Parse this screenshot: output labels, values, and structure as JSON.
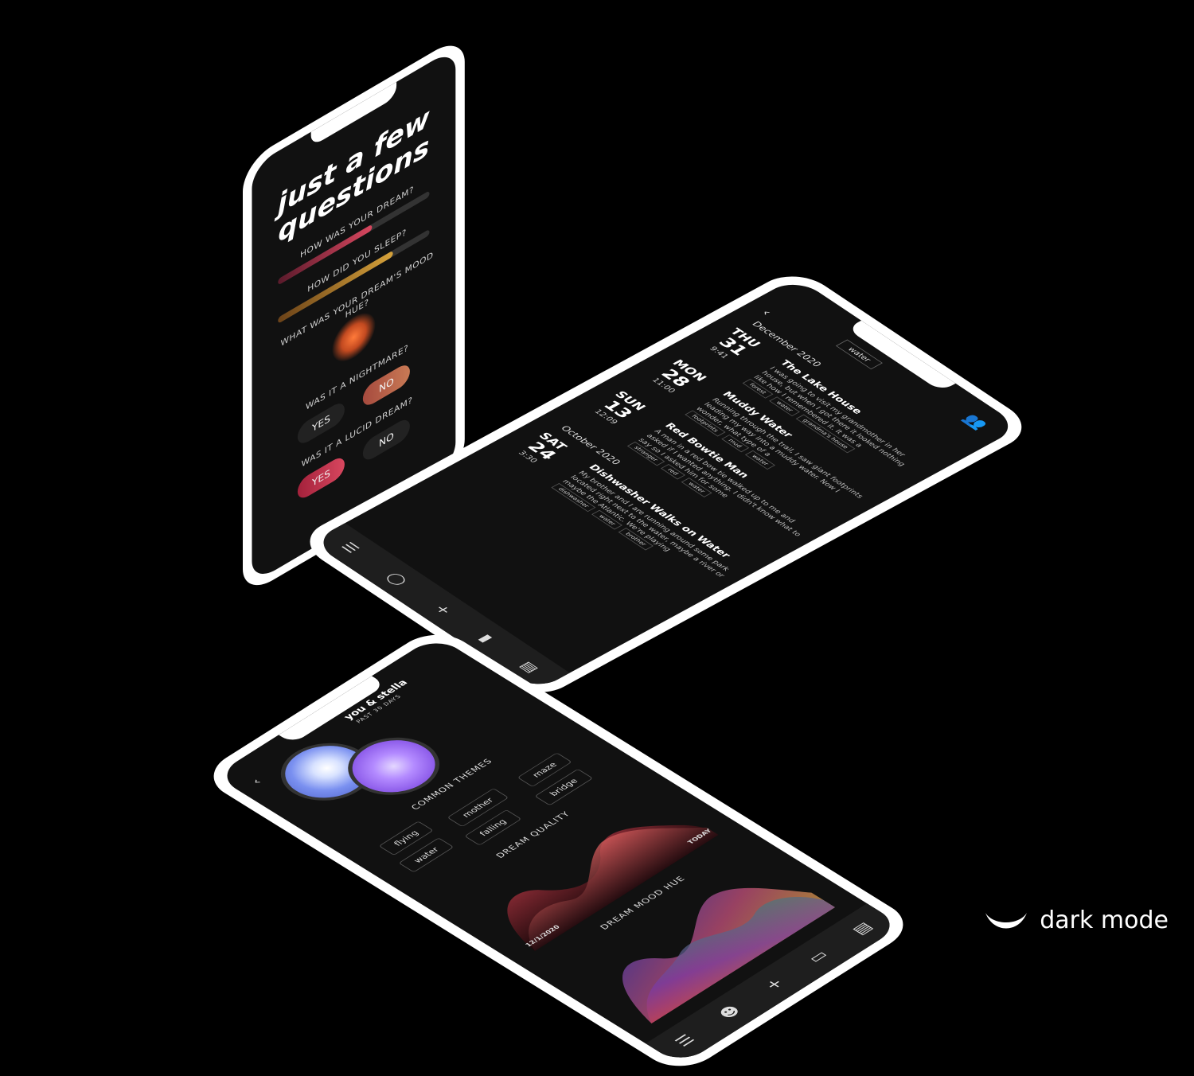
{
  "questions": {
    "title": "just a few\nquestions",
    "q1": "HOW WAS YOUR DREAM?",
    "q1_level": 0.62,
    "q2": "HOW DID YOU SLEEP?",
    "q2_level": 0.76,
    "q3": "WHAT WAS YOUR DREAM'S MOOD HUE?",
    "q4": "WAS IT A NIGHTMARE?",
    "q4_yes": "YES",
    "q4_no": "NO",
    "q5": "WAS IT A LUCID DREAM?",
    "q5_yes": "YES",
    "q5_no": "NO"
  },
  "journal": {
    "filter": "water",
    "months": [
      "December 2020",
      "October 2020"
    ],
    "entries": [
      {
        "dow": "THU",
        "day": "31",
        "time": "9:41",
        "title": "The Lake House",
        "text": "I was going to visit my grandmother in her house, but when I got there it looked nothing like how I remembered it. It was a",
        "tags": [
          "forest",
          "water",
          "grandma's house"
        ]
      },
      {
        "dow": "MON",
        "day": "28",
        "time": "11:00",
        "title": "Muddy Water",
        "text": "Running through the trail, I saw giant footprints leading my way into a muddy water. Now I wonder, what type of a",
        "tags": [
          "footprints",
          "mud",
          "water"
        ]
      },
      {
        "dow": "SUN",
        "day": "13",
        "time": "12:09",
        "title": "Red Bowtie Man",
        "text": "A man in a red bow tie walked up to me and asked if I wanted anything. I didn't know what to say so I asked him for some",
        "tags": [
          "stranger",
          "red",
          "water"
        ]
      },
      {
        "dow": "SAT",
        "day": "24",
        "time": "3:30",
        "title": "Dishwasher Walks on Water",
        "text": "My brother and I are running around some park located right next to the water, maybe a river or maybe the Atlantic. We're playing",
        "tags": [
          "dishwasher",
          "water",
          "brother"
        ]
      }
    ]
  },
  "insights": {
    "who": "you & stella",
    "period": "PAST 30 DAYS",
    "themes_title": "COMMON THEMES",
    "themes": [
      "flying",
      "water",
      "mother",
      "falling",
      "maze",
      "bridge"
    ],
    "quality_title": "DREAM QUALITY",
    "start_date": "12/1/2020",
    "end_label": "TODAY",
    "hue_title": "DREAM MOOD HUE"
  },
  "brand": {
    "text": "dark mode"
  },
  "colors": {
    "background": "#000000",
    "phone_frame": "#ffffff",
    "screen": "#111111",
    "accent_red": "#d8475f",
    "accent_gold": "#c99a2e"
  }
}
